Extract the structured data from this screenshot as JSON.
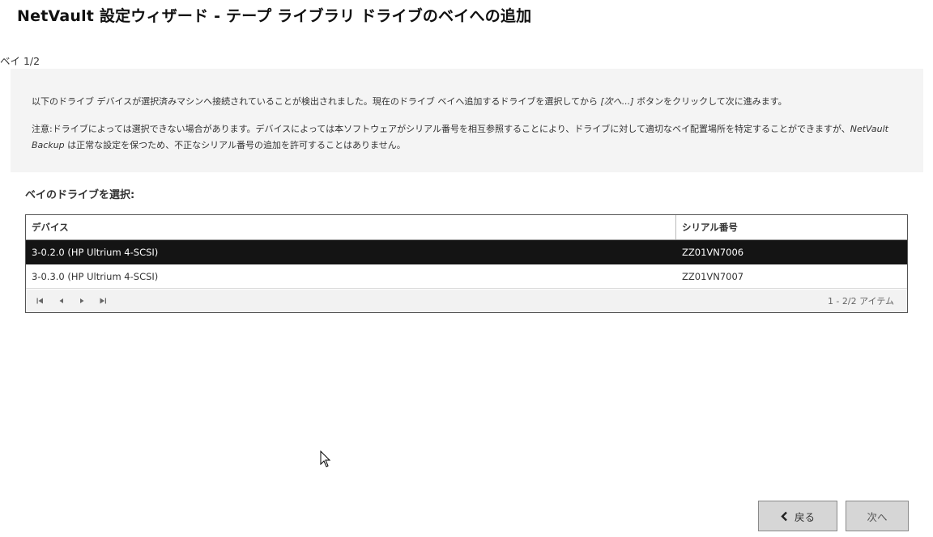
{
  "page": {
    "title": "NetVault 設定ウィザード - テープ ライブラリ ドライブのベイへの追加",
    "bay_label": "ベイ 1/2"
  },
  "info": {
    "line1_text": "以下のドライブ デバイスが選択済みマシンへ接続されていることが検出されました。現在のドライブ ベイへ追加するドライブを選択してから ",
    "line1_next_ref": "[次へ...]",
    "line1_tail": " ボタンをクリックして次に進みます。",
    "line2_text": "注意:ドライブによっては選択できない場合があります。デバイスによっては本ソフトウェアがシリアル番号を相互参照することにより、ドライブに対して適切なベイ配置場所を特定することができますが、",
    "line2_product": "NetVault Backup",
    "line2_tail": " は正常な設定を保つため、不正なシリアル番号の追加を許可することはありません。"
  },
  "select_label": "ベイのドライブを選択:",
  "grid": {
    "headers": {
      "device": "デバイス",
      "serial": "シリアル番号"
    },
    "rows": [
      {
        "device": "3-0.2.0 (HP Ultrium 4-SCSI)",
        "serial": "ZZ01VN7006",
        "selected": true
      },
      {
        "device": "3-0.3.0 (HP Ultrium 4-SCSI)",
        "serial": "ZZ01VN7007",
        "selected": false
      }
    ],
    "pager": {
      "first_icon": "first-page-icon",
      "prev_icon": "prev-page-icon",
      "next_icon": "next-page-icon",
      "last_icon": "last-page-icon",
      "info": "1 - 2/2 アイテム"
    }
  },
  "buttons": {
    "back_label": "戻る",
    "back_icon": "chevron-left-icon",
    "next_label": "次へ"
  },
  "colors": {
    "selected_row": "#141414",
    "info_bg": "#f4f4f4",
    "button_bg": "#d6d6d6"
  }
}
